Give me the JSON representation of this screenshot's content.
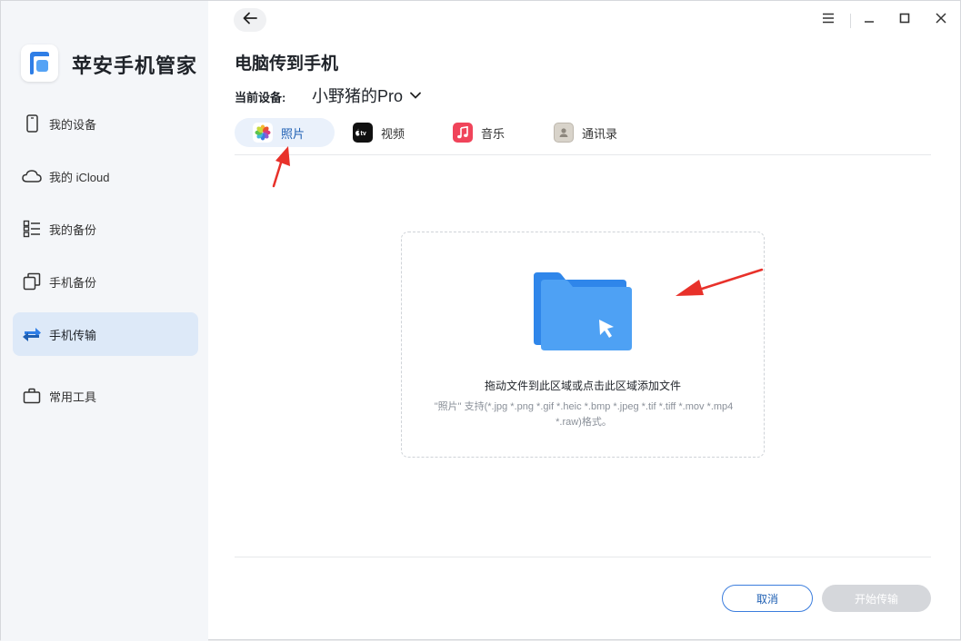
{
  "app": {
    "name": "苹安手机管家",
    "accent": "#3b7ddd"
  },
  "sidebar": {
    "items": [
      {
        "label": "我的设备",
        "icon": "phone-icon"
      },
      {
        "label": "我的 iCloud",
        "icon": "cloud-icon"
      },
      {
        "label": "我的备份",
        "icon": "list-icon"
      },
      {
        "label": "手机备份",
        "icon": "copy-icon"
      },
      {
        "label": "手机传输",
        "icon": "transfer-icon",
        "active": true
      },
      {
        "label": "常用工具",
        "icon": "toolbox-icon"
      }
    ]
  },
  "header": {
    "title": "电脑传到手机",
    "device_label": "当前设备:",
    "device_name": "小野猪的Pro"
  },
  "tabs": [
    {
      "label": "照片",
      "icon": "photos-icon",
      "active": true
    },
    {
      "label": "视频",
      "icon": "tv-icon"
    },
    {
      "label": "音乐",
      "icon": "music-icon"
    },
    {
      "label": "通讯录",
      "icon": "contacts-icon"
    }
  ],
  "dropzone": {
    "title": "拖动文件到此区域或点击此区域添加文件",
    "desc_line1": "\"照片\" 支持(*.jpg *.png *.gif *.heic *.bmp *.jpeg *.tif *.tiff *.mov *.mp4",
    "desc_line2": "*.raw)格式。"
  },
  "footer": {
    "cancel_label": "取消",
    "start_label": "开始传输"
  },
  "colors": {
    "active_bg": "#dde9f8",
    "disabled_btn": "#d5d7db",
    "annotation": "#e8312a"
  }
}
